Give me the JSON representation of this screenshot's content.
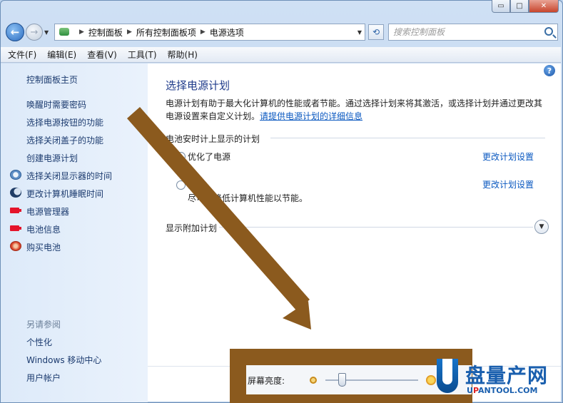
{
  "window": {
    "caption_buttons": {
      "minimize": "▭",
      "maximize": "□",
      "close": "✕"
    }
  },
  "navigation": {
    "back": "←",
    "forward": "→",
    "breadcrumb": [
      "控制面板",
      "所有控制面板项",
      "电源选项"
    ],
    "search_placeholder": "搜索控制面板"
  },
  "menu": [
    "文件(F)",
    "编辑(E)",
    "查看(V)",
    "工具(T)",
    "帮助(H)"
  ],
  "sidebar": {
    "home": "控制面板主页",
    "items": [
      {
        "label": "唤醒时需要密码",
        "icon": ""
      },
      {
        "label": "选择电源按钮的功能",
        "icon": ""
      },
      {
        "label": "选择关闭盖子的功能",
        "icon": ""
      },
      {
        "label": "创建电源计划",
        "icon": ""
      },
      {
        "label": "选择关闭显示器的时间",
        "icon": "clock-icon"
      },
      {
        "label": "更改计算机睡眠时间",
        "icon": "moon-icon"
      },
      {
        "label": "电源管理器",
        "icon": "battery-icon"
      },
      {
        "label": "电池信息",
        "icon": "battery-icon"
      },
      {
        "label": "购买电池",
        "icon": "globe-icon"
      }
    ],
    "see_also": "另请参阅",
    "see_also_items": [
      "个性化",
      "Windows 移动中心",
      "用户帐户"
    ]
  },
  "main": {
    "help": "?",
    "title": "选择电源计划",
    "description_line1": "电源计划有助于最大化计算机的性能或者节能。通过选择计划来将其激活，或选择计划并通过更改其",
    "description_line2_prefix": "电源设置来自定义计划。",
    "description_link": "请提供电源计划的详细信息",
    "section_header": "电池安时计上显示的计划",
    "plans": [
      {
        "name": "优化了电源",
        "description": "",
        "selected": true,
        "link": "更改计划设置"
      },
      {
        "name": "能",
        "description": "尽可能降低计算机性能以节能。",
        "selected": false,
        "link": "更改计划设置"
      }
    ],
    "additional_header": "显示附加计划"
  },
  "brightness": {
    "label": "屏幕亮度:",
    "level": 0.15
  },
  "watermark": {
    "text": "盘量产网",
    "sub_prefix": "U",
    "sub_red": "P",
    "sub_rest": "ANTOOL.COM"
  },
  "colors": {
    "link": "#0a58c0",
    "title": "#1f3b8a",
    "arrow": "#8b5a1e"
  }
}
